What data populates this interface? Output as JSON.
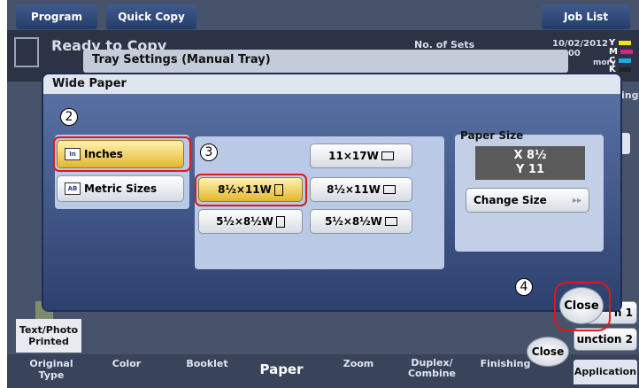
{
  "top_tabs": {
    "program": "Program",
    "quick_copy": "Quick Copy",
    "job_list": "Job List"
  },
  "status": {
    "ready": "Ready to Copy",
    "no_of_sets": "No. of Sets",
    "datetime": "10/02/2012\n10:00",
    "memory": "mory",
    "toner": [
      "Y",
      "M",
      "C",
      "K"
    ]
  },
  "dialogs": {
    "manual_tray_title": "Tray Settings (Manual Tray)",
    "wide_paper_title": "Wide Paper"
  },
  "units": {
    "inches": "Inches",
    "metric": "Metric Sizes"
  },
  "sizes": [
    {
      "label": "11×17W",
      "orient": "landscape"
    },
    {
      "label": "8½×11W",
      "orient": "portrait",
      "selected": true
    },
    {
      "label": "8½×11W",
      "orient": "landscape"
    },
    {
      "label": "5½×8½W",
      "orient": "portrait"
    },
    {
      "label": "5½×8½W",
      "orient": "landscape"
    }
  ],
  "paper_size": {
    "header": "Paper Size",
    "x": "X  8½",
    "y": "Y  11",
    "change_size": "Change Size",
    "arrows": "▸▸"
  },
  "steps": {
    "s2": "2",
    "s3": "3",
    "s4": "4"
  },
  "close_main": "Close",
  "close_back": "Close",
  "side_labels": {
    "ing": "ing",
    "function1": "n 1",
    "function2": "unction 2",
    "text_photo": "Text/Photo\nPrinted"
  },
  "bottom_tabs": [
    "Original Type",
    "Color",
    "Booklet",
    "Paper",
    "Zoom",
    "Duplex/\nCombine",
    "Finishing",
    "Application"
  ],
  "colors": {
    "selected": "#e2b72f",
    "highlight_ring": "#e01818",
    "toner_y": "#f5e010",
    "toner_m": "#e0208a",
    "toner_c": "#20a8e0",
    "toner_k": "#222222"
  }
}
